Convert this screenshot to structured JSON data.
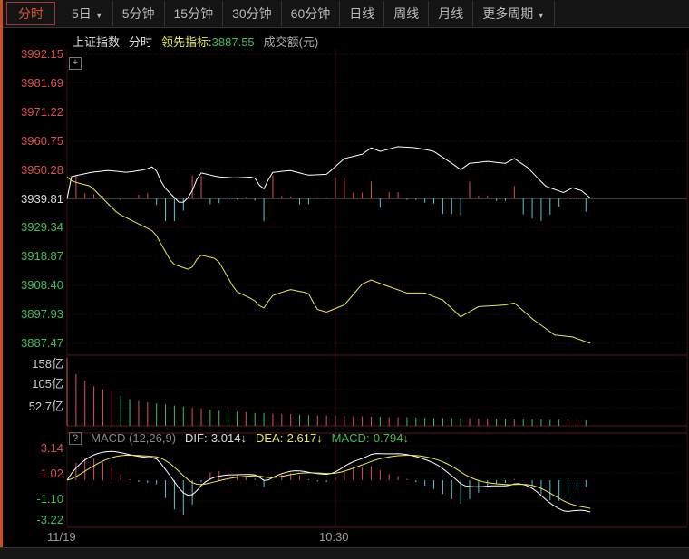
{
  "toolbar": {
    "tabs": [
      "分时",
      "5日",
      "5分钟",
      "15分钟",
      "30分钟",
      "60分钟",
      "日线",
      "周线",
      "月线",
      "更多周期"
    ],
    "active": "分时"
  },
  "info": {
    "index_name": "上证指数",
    "mode": "分时",
    "leading_label": "领先指标:",
    "leading_value": "3887.55",
    "volume_label": "成交额(元)"
  },
  "macd_info": {
    "help": "?",
    "title": "MACD (12,26,9)",
    "dif": "DIF:-3.014↓",
    "dea": "DEA:-2.617↓",
    "macd": "MACD:-0.794↓"
  },
  "colors": {
    "up": "#e25050",
    "down": "#3cc05a",
    "price": "#ffffff",
    "leading": "#e8e85a",
    "grid": "#3a1010"
  },
  "chart_data": {
    "type": "line",
    "price_ticks": [
      "3992.15",
      "3981.69",
      "3971.22",
      "3960.75",
      "3950.28",
      "3939.81",
      "3929.34",
      "3918.87",
      "3908.40",
      "3897.93",
      "3887.47"
    ],
    "prev_close": 3939.81,
    "ylim": [
      3887.47,
      3992.15
    ],
    "volume_ticks": [
      "158亿",
      "105亿",
      "52.7亿"
    ],
    "volume_max": 158,
    "macd_ticks": [
      "3.14",
      "1.02",
      "-1.10",
      "-3.22"
    ],
    "macd_ylim": [
      -3.22,
      3.14
    ],
    "x_ticks": [
      "11/19",
      "10:30"
    ],
    "minutes_total": 120,
    "index_series": [
      [
        0,
        3939.8
      ],
      [
        0.8,
        3947.8
      ],
      [
        5.3,
        3949.4
      ],
      [
        9.3,
        3950.1
      ],
      [
        13.4,
        3949.4
      ],
      [
        17.4,
        3950.4
      ],
      [
        19.5,
        3951.7
      ],
      [
        21.5,
        3944.4
      ],
      [
        25.5,
        3937.8
      ],
      [
        27.6,
        3941.1
      ],
      [
        29.6,
        3949.4
      ],
      [
        33.6,
        3947.8
      ],
      [
        37.7,
        3947.4
      ],
      [
        41.8,
        3947.8
      ],
      [
        43.8,
        3942.8
      ],
      [
        45.8,
        3949.4
      ],
      [
        49.9,
        3950.1
      ],
      [
        53.9,
        3948.4
      ],
      [
        58,
        3948.7
      ],
      [
        62,
        3954.4
      ],
      [
        66,
        3956.0
      ],
      [
        68,
        3958.3
      ],
      [
        70,
        3957.0
      ],
      [
        74,
        3958.7
      ],
      [
        78,
        3958.3
      ],
      [
        80,
        3957.7
      ],
      [
        82,
        3957.0
      ],
      [
        86,
        3952.7
      ],
      [
        88,
        3950.4
      ],
      [
        90,
        3952.7
      ],
      [
        94,
        3953.4
      ],
      [
        98,
        3952.7
      ],
      [
        100,
        3954.4
      ],
      [
        103,
        3951.1
      ],
      [
        107,
        3944.4
      ],
      [
        111,
        3942.1
      ],
      [
        113,
        3943.8
      ],
      [
        115,
        3942.8
      ],
      [
        117,
        3940.1
      ]
    ],
    "leading_series": [
      [
        0,
        3947.8
      ],
      [
        1.2,
        3946.1
      ],
      [
        5.3,
        3944.4
      ],
      [
        9.3,
        3937.8
      ],
      [
        11.4,
        3934.5
      ],
      [
        15.4,
        3931.2
      ],
      [
        19.5,
        3927.9
      ],
      [
        23.5,
        3916.3
      ],
      [
        27.6,
        3914.0
      ],
      [
        29.6,
        3919.6
      ],
      [
        33.6,
        3918.0
      ],
      [
        37.7,
        3906.4
      ],
      [
        41.8,
        3903.2
      ],
      [
        43.8,
        3899.8
      ],
      [
        45.8,
        3904.7
      ],
      [
        49.9,
        3907.0
      ],
      [
        53.9,
        3905.7
      ],
      [
        55.9,
        3899.8
      ],
      [
        58,
        3898.8
      ],
      [
        62,
        3901.4
      ],
      [
        66,
        3909.0
      ],
      [
        68,
        3910.4
      ],
      [
        72,
        3908.0
      ],
      [
        76,
        3905.7
      ],
      [
        80,
        3905.7
      ],
      [
        84,
        3903.2
      ],
      [
        88,
        3897.1
      ],
      [
        92,
        3900.8
      ],
      [
        98,
        3901.4
      ],
      [
        100,
        3902.1
      ],
      [
        104,
        3896.4
      ],
      [
        109,
        3890.5
      ],
      [
        113,
        3889.8
      ],
      [
        117,
        3887.5
      ]
    ],
    "volume": [
      158,
      120,
      105,
      92,
      85,
      80,
      70,
      62,
      58,
      55,
      52,
      50,
      47,
      45,
      42,
      40,
      38,
      36,
      35,
      33,
      32,
      30,
      30,
      28,
      27,
      27,
      26,
      25,
      24,
      24,
      23,
      23,
      22,
      22,
      21,
      21,
      20,
      20,
      20,
      19,
      19,
      18,
      18,
      18,
      17,
      17,
      17,
      16,
      16,
      16,
      15,
      15,
      15,
      15,
      14,
      14,
      14,
      13,
      13
    ]
  }
}
